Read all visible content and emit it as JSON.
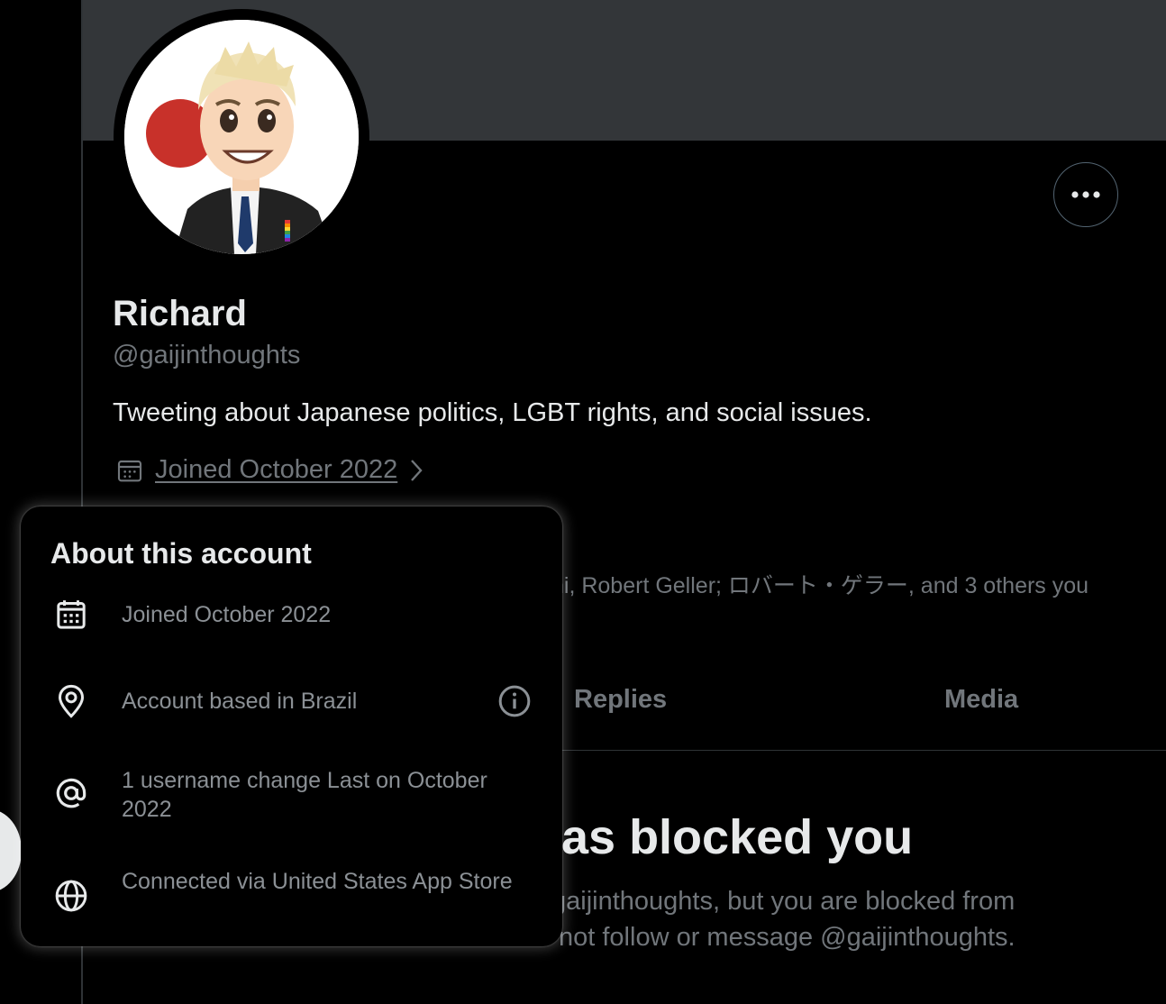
{
  "profile": {
    "display_name": "Richard",
    "handle": "@gaijinthoughts",
    "bio": "Tweeting about Japanese politics, LGBT rights, and social issues.",
    "joined_link": "Joined October 2022",
    "followed_by": "ni, Robert Geller; ロバート・ゲラー, and 3 others you"
  },
  "tabs": {
    "replies": "Replies",
    "media": "Media"
  },
  "blocked": {
    "title": "as blocked you",
    "line1": "gaijinthoughts, but you are blocked from",
    "line2": "not follow or message @gaijinthoughts."
  },
  "about_popover": {
    "title": "About this account",
    "joined": "Joined October 2022",
    "based_in": "Account based in Brazil",
    "username_changes": "1 username change Last on October 2022",
    "connected_via": "Connected via United States App Store"
  },
  "colors": {
    "background": "#000000",
    "banner": "#333639",
    "text_primary": "#e7e9ea",
    "text_secondary": "#71767b",
    "border": "#2f3336"
  },
  "icons": [
    "calendar-icon",
    "chevron-right-icon",
    "more-options-icon",
    "location-pin-icon",
    "info-icon",
    "at-sign-icon",
    "globe-icon"
  ]
}
